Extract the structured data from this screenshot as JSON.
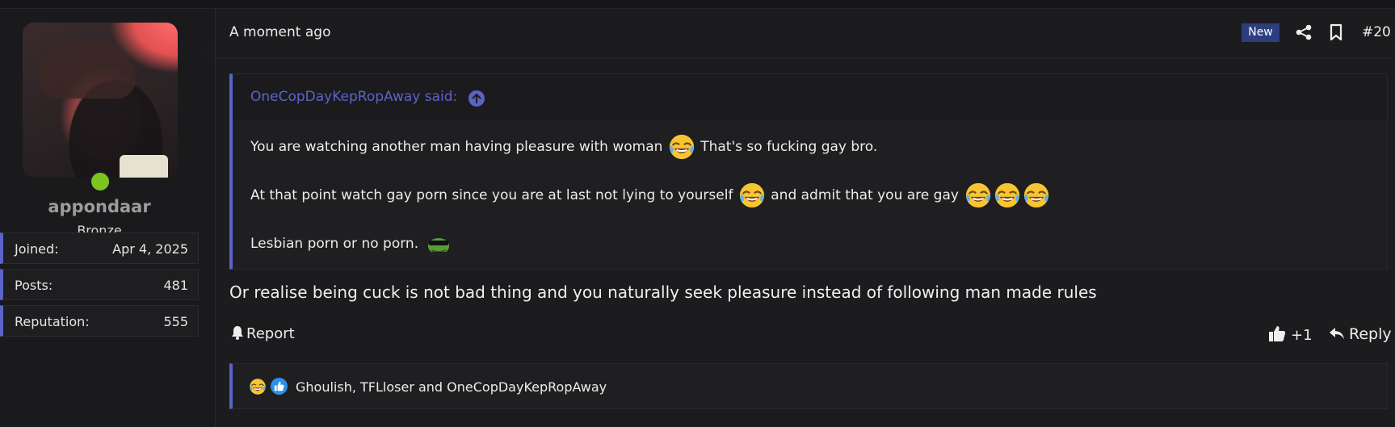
{
  "user": {
    "username": "appondaar",
    "rank": "Bronze",
    "online": true,
    "stats": [
      {
        "label": "Joined:",
        "value": "Apr 4, 2025"
      },
      {
        "label": "Posts:",
        "value": "481"
      },
      {
        "label": "Reputation:",
        "value": "555"
      }
    ]
  },
  "post": {
    "timestamp": "A moment ago",
    "new_badge": "New",
    "number": "#20",
    "quote": {
      "author": "OneCopDayKepRopAway said:",
      "line1_a": "You are watching another man having pleasure with woman",
      "line1_b": "That's so fucking gay bro.",
      "line2_a": "At that point watch gay porn since you are at last not lying to yourself",
      "line2_b": "and admit that you are gay",
      "line3": "Lesbian porn or no porn."
    },
    "body": "Or realise being cuck is not bad thing and you naturally seek pleasure instead of following man made rules",
    "actions": {
      "report": "Report",
      "like_count": "+1",
      "reply": "Reply"
    },
    "reactions": {
      "users": "Ghoulish, TFLloser and OneCopDayKepRopAway"
    }
  },
  "colors": {
    "accent": "#5b63c8",
    "badge_bg": "#2d3e7e",
    "online": "#7cc520",
    "background": "#1c1c1e"
  },
  "icons": {
    "share": "share-icon",
    "bookmark": "bookmark-icon",
    "jump": "arrow-up-circle-icon",
    "report": "bell-icon",
    "like": "thumbs-up-icon",
    "reply": "reply-arrow-icon",
    "laughing_emoji": "laughing-crying-emoji",
    "pepe_emoji": "pepe-sunglasses-emoji"
  }
}
